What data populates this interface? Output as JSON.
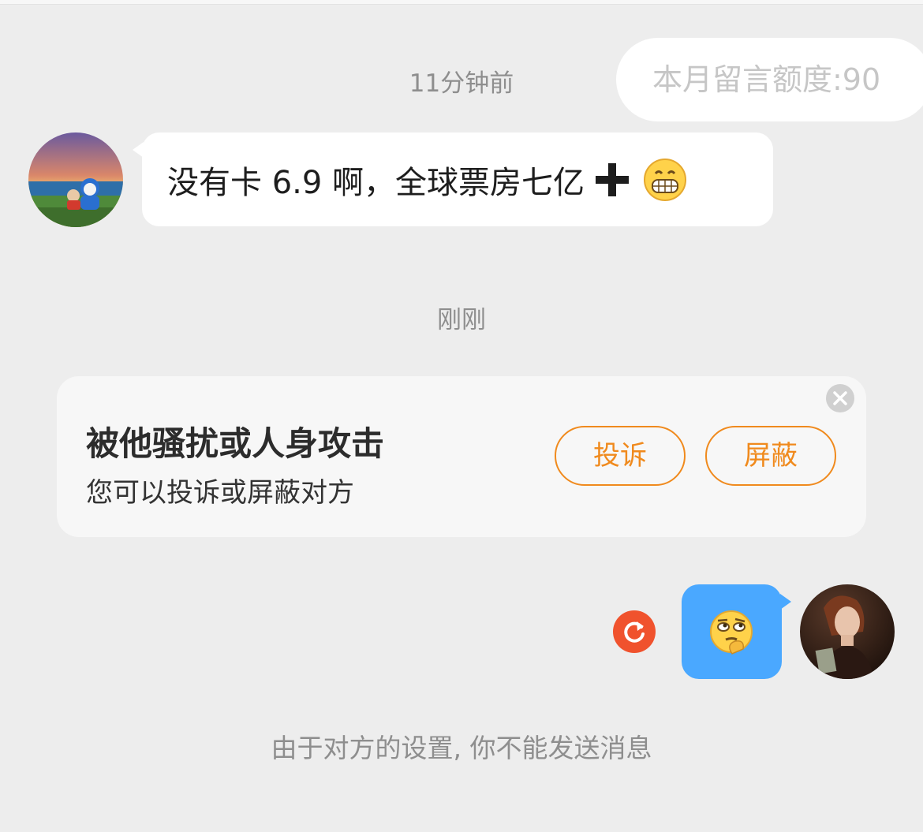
{
  "quota": {
    "text": "本月留言额度:90"
  },
  "timestamps": {
    "first": "11分钟前",
    "second": "刚刚"
  },
  "incoming_message": {
    "text": "没有卡 6.9 啊，全球票房七亿",
    "icons": [
      "heavy-plus-icon",
      "grinning-face-emoji"
    ]
  },
  "warning_card": {
    "title": "被他骚扰或人身攻击",
    "subtitle": "您可以投诉或屏蔽对方",
    "report_label": "投诉",
    "block_label": "屏蔽",
    "close_icon": "close-icon"
  },
  "outgoing_message": {
    "emoji": "thinking-eye-roll-emoji",
    "status_icon": "resend-icon"
  },
  "footer_notice": "由于对方的设置, 你不能发送消息",
  "colors": {
    "background": "#ededed",
    "accent": "#f08a1d",
    "outgoing_bubble": "#4aa8ff",
    "resend": "#f0522d"
  }
}
